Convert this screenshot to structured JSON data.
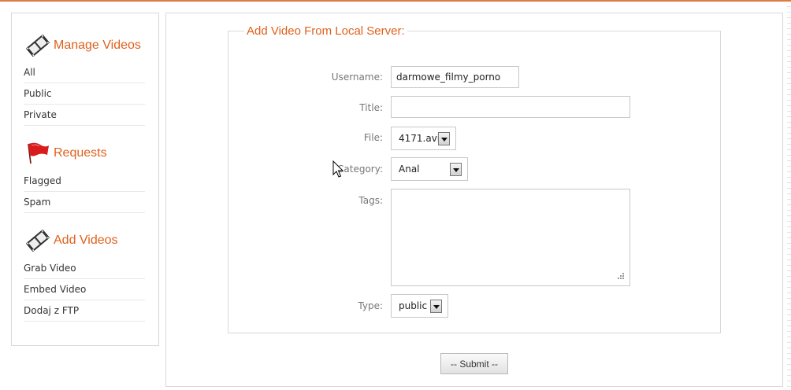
{
  "sidebar": {
    "sections": [
      {
        "title": "Manage Videos",
        "icon": "film-reel-icon",
        "items": [
          {
            "label": "All"
          },
          {
            "label": "Public"
          },
          {
            "label": "Private"
          }
        ]
      },
      {
        "title": "Requests",
        "icon": "red-flag-icon",
        "items": [
          {
            "label": "Flagged"
          },
          {
            "label": "Spam"
          }
        ]
      },
      {
        "title": "Add Videos",
        "icon": "film-reel-icon",
        "items": [
          {
            "label": "Grab Video"
          },
          {
            "label": "Embed Video"
          },
          {
            "label": "Dodaj z FTP"
          }
        ]
      }
    ]
  },
  "form": {
    "legend": "Add Video From Local Server:",
    "username": {
      "label": "Username:",
      "value": "darmowe_filmy_porno"
    },
    "title": {
      "label": "Title:",
      "value": ""
    },
    "file": {
      "label": "File:",
      "value": "4171.avi"
    },
    "category": {
      "label": "Category:",
      "value": "Anal"
    },
    "tags": {
      "label": "Tags:",
      "value": ""
    },
    "type": {
      "label": "Type:",
      "value": "public"
    },
    "submit_label": "-- Submit --"
  },
  "colors": {
    "accent": "#e0601c",
    "border": "#d8d8d8"
  }
}
